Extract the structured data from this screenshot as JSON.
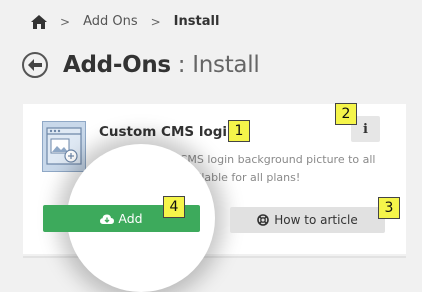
{
  "breadcrumb": {
    "home_icon": "home-icon",
    "separator": ">",
    "items": [
      "Add Ons",
      "Install"
    ]
  },
  "header": {
    "back_icon": "arrow-left-circle-icon",
    "title": "Add-Ons",
    "subtitle": " : Install"
  },
  "addon": {
    "icon": "image-window-icon",
    "name": "Custom CMS login",
    "description": "Add a Custom CMS login background picture to all your projects. Available for all plans!",
    "info_label": "i",
    "add_label": "Add",
    "add_icon": "cloud-download-icon",
    "howto_label": "How to article",
    "howto_icon": "lifebuoy-icon"
  },
  "markers": [
    "1",
    "2",
    "3",
    "4"
  ],
  "colors": {
    "add_button": "#3daa5c",
    "marker": "#f5f54a",
    "background": "#f1f1f1"
  }
}
